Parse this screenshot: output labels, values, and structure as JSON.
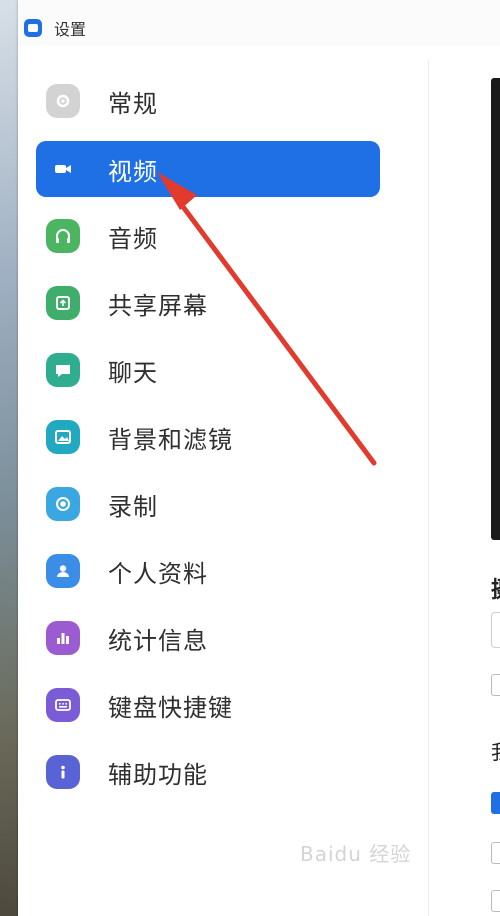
{
  "window": {
    "title": "设置"
  },
  "sidebar": {
    "items": [
      {
        "label": "常规",
        "icon": "gear-icon",
        "color": "#c9c9c9",
        "active": false
      },
      {
        "label": "视频",
        "icon": "camera-icon",
        "color": "#ffffff",
        "active": true
      },
      {
        "label": "音频",
        "icon": "headphones-icon",
        "color": "#4cb561",
        "active": false
      },
      {
        "label": "共享屏幕",
        "icon": "share-screen-icon",
        "color": "#3fae6a",
        "active": false
      },
      {
        "label": "聊天",
        "icon": "chat-bubble-icon",
        "color": "#2fae8f",
        "active": false
      },
      {
        "label": "背景和滤镜",
        "icon": "image-icon",
        "color": "#22a8c0",
        "active": false
      },
      {
        "label": "录制",
        "icon": "record-icon",
        "color": "#3ba7e2",
        "active": false
      },
      {
        "label": "个人资料",
        "icon": "user-icon",
        "color": "#3b8ee8",
        "active": false
      },
      {
        "label": "统计信息",
        "icon": "bar-chart-icon",
        "color": "#9b5bd1",
        "active": false
      },
      {
        "label": "键盘快捷键",
        "icon": "keyboard-icon",
        "color": "#7b5cd6",
        "active": false
      },
      {
        "label": "辅助功能",
        "icon": "info-icon",
        "color": "#5a63d6",
        "active": false
      }
    ]
  },
  "content": {
    "heading_fragment": "摄",
    "heading2_fragment": "我"
  },
  "watermark": {
    "text": "Baidu 经验"
  },
  "colors": {
    "accent": "#1f6fe5",
    "annotation_arrow": "#e23a2c"
  }
}
